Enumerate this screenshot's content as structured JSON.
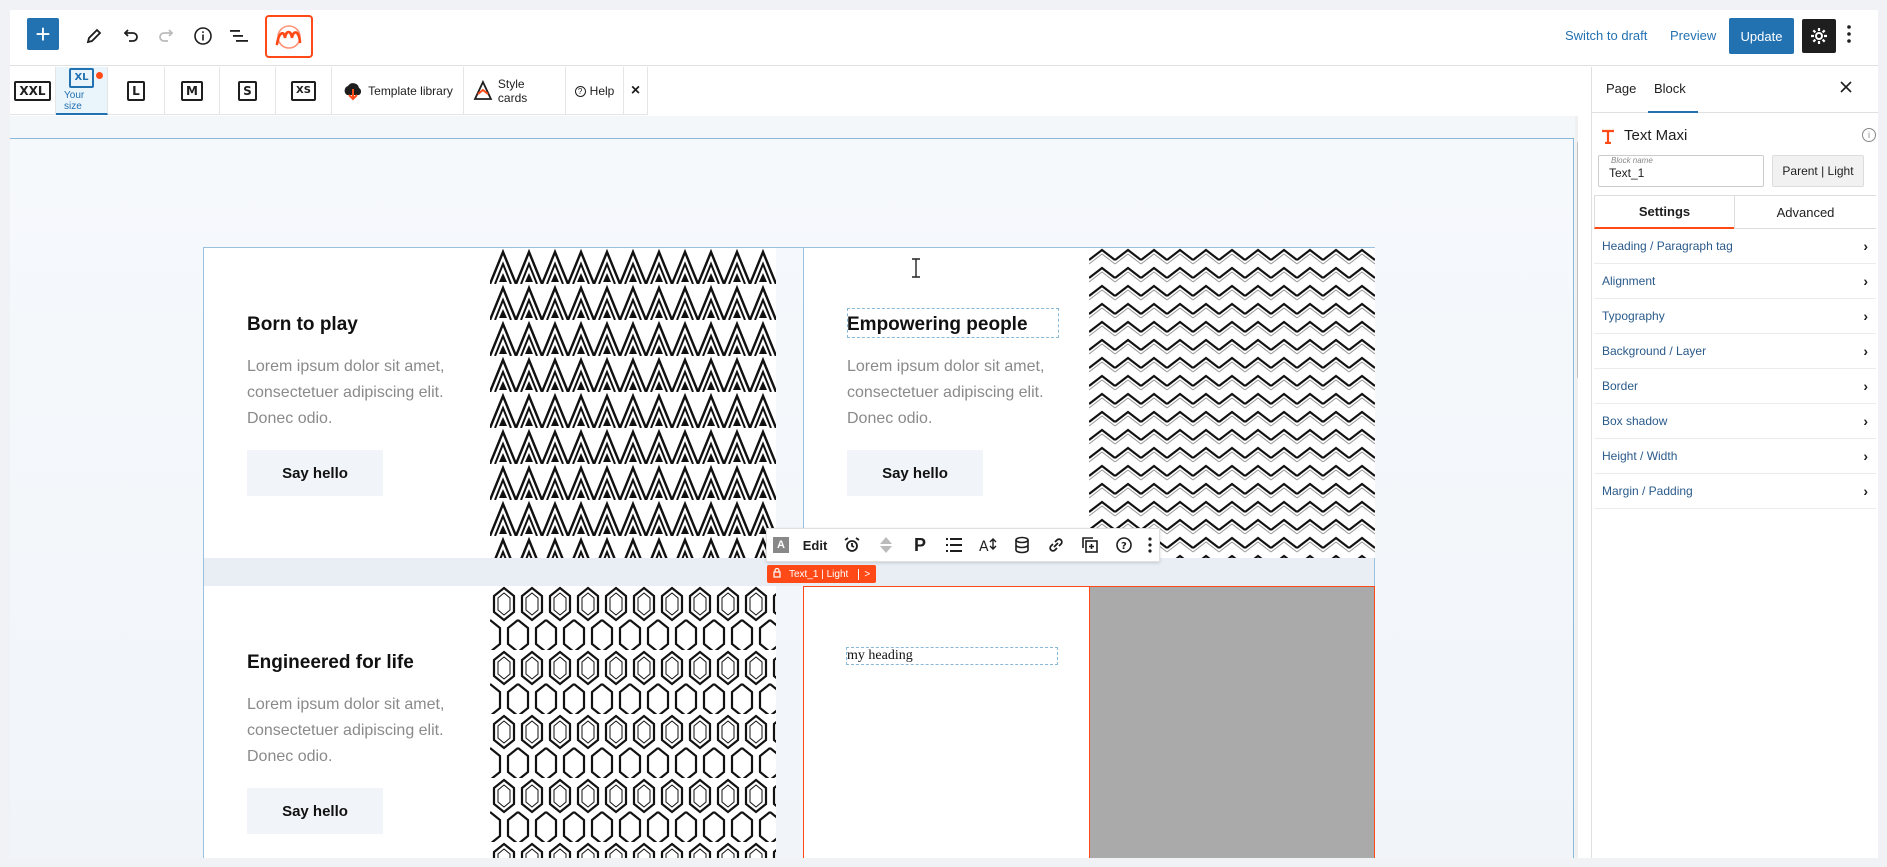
{
  "topbar": {
    "add_icon": "plus-icon",
    "tools_icon": "pencil-icon",
    "undo_icon": "undo-icon",
    "redo_icon": "redo-icon",
    "info_icon": "info-icon",
    "list_view_icon": "list-view-icon",
    "logo": "maxi-logo",
    "switch_to_draft": "Switch to draft",
    "preview": "Preview",
    "update": "Update"
  },
  "responsive_bar": {
    "items": [
      {
        "icon": "XXL",
        "label": ""
      },
      {
        "icon": "XL",
        "label": "Your size"
      },
      {
        "icon": "L",
        "label": ""
      },
      {
        "icon": "M",
        "label": ""
      },
      {
        "icon": "S",
        "label": ""
      },
      {
        "icon": "XS",
        "label": ""
      }
    ],
    "template_library": "Template library",
    "style_cards": "Style cards",
    "help": "Help",
    "close": "×"
  },
  "canvas": {
    "cards": [
      {
        "title": "Born to play",
        "body": "Lorem ipsum dolor sit amet, consectetuer adipiscing elit. Donec odio.",
        "button": "Say hello"
      },
      {
        "title": "Empowering people",
        "body": "Lorem ipsum dolor sit amet, consectetuer adipiscing elit. Donec odio.",
        "button": "Say hello"
      },
      {
        "title": "Engineered for life",
        "body": "Lorem ipsum dolor sit amet, consectetuer adipiscing elit. Donec odio.",
        "button": "Say hello"
      },
      {
        "title": "my heading"
      }
    ],
    "block_toolbar": {
      "edit": "Edit",
      "paragraph_glyph": "P",
      "icons": [
        "text-type-icon",
        "alarm-icon",
        "alignment-icon",
        "paragraph-icon",
        "list-icon",
        "font-size-icon",
        "database-icon",
        "link-icon",
        "copy-icon",
        "help-icon",
        "more-icon"
      ]
    },
    "breadcrumb": {
      "label": "Text_1 | Light",
      "arrow": ">"
    }
  },
  "sidebar": {
    "tabs": [
      "Page",
      "Block"
    ],
    "active_tab": "Block",
    "block_title": "Text Maxi",
    "block_name_label": "Block name",
    "block_name_value": "Text_1",
    "parent_button": "Parent | Light",
    "sub_tabs": [
      "Settings",
      "Advanced"
    ],
    "panels": [
      "Heading / Paragraph tag",
      "Alignment",
      "Typography",
      "Background / Layer",
      "Border",
      "Box shadow",
      "Height / Width",
      "Margin / Padding"
    ]
  },
  "colors": {
    "accent_blue": "#2271b1",
    "maxi_orange": "#ff4a17",
    "gray_block": "#aaaaaa"
  }
}
